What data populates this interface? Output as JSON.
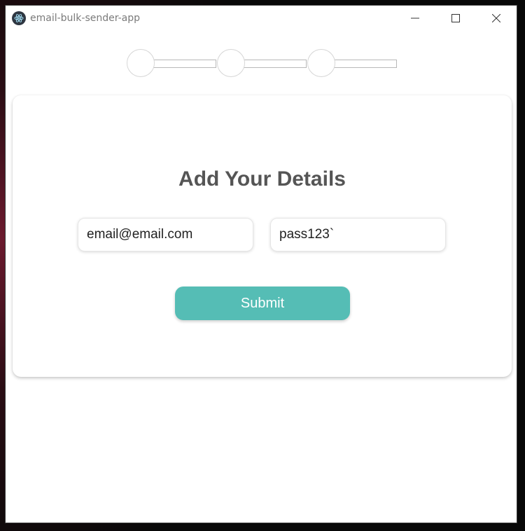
{
  "window": {
    "title": "email-bulk-sender-app",
    "controls": [
      "minimize-icon",
      "maximize-icon",
      "close-icon"
    ]
  },
  "stepper": {
    "steps": 3
  },
  "form": {
    "heading": "Add Your Details",
    "email_value": "email@email.com",
    "password_value": "pass123`",
    "submit_label": "Submit"
  },
  "colors": {
    "accent": "#55bdb5",
    "heading": "#555555"
  }
}
